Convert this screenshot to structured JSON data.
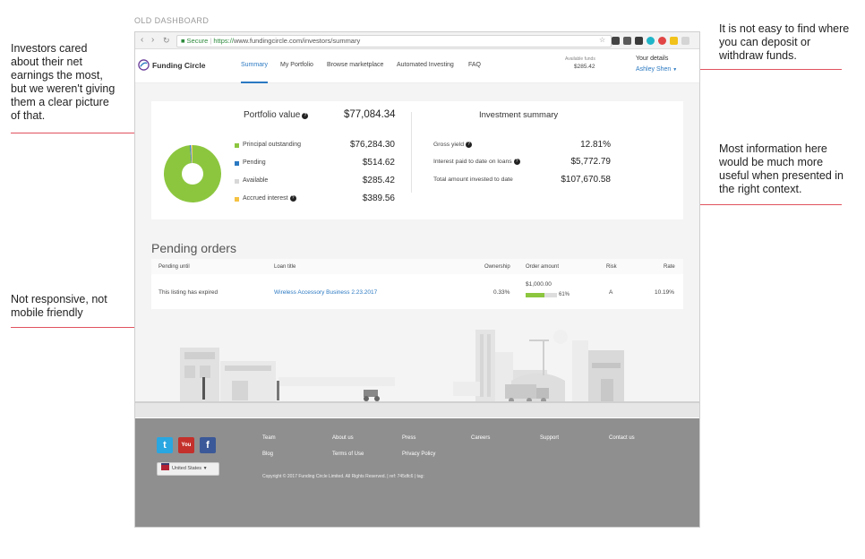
{
  "caption": "OLD DASHBOARD",
  "annotations": [
    {
      "id": "earnings",
      "text": "Investors cared about their net earnings the most, but we weren't giving them a clear picture of that."
    },
    {
      "id": "deposit",
      "text": "It is not easy to find where you can deposit or withdraw funds."
    },
    {
      "id": "context",
      "text": "Most information here would be much more useful when presented in the right context."
    },
    {
      "id": "mobile",
      "text": "Not responsive, not mobile friendly"
    }
  ],
  "browser": {
    "secure_label": "Secure",
    "url_scheme": "https://",
    "url_rest": "www.fundingcircle.com/investors/summary",
    "extension_colors": [
      "#444444",
      "#5a5a5a",
      "#3a3a3a",
      "#20b5c8",
      "#e24545",
      "#f1c21b",
      "#d5d5d5"
    ]
  },
  "header": {
    "logo": "Funding Circle",
    "nav": [
      "Summary",
      "My Portfolio",
      "Browse marketplace",
      "Automated Investing",
      "FAQ"
    ],
    "active_nav": "Summary",
    "available_funds_label": "Available funds",
    "available_funds_value": "$285.42",
    "your_details": "Your details",
    "user_name": "Ashley Shen"
  },
  "portfolio": {
    "title": "Portfolio value",
    "total": "$77,084.34",
    "items": [
      {
        "label": "Principal outstanding",
        "value": "$76,284.30",
        "color": "#8cc63f"
      },
      {
        "label": "Pending",
        "value": "$514.62",
        "color": "#2b79c2"
      },
      {
        "label": "Available",
        "value": "$285.42",
        "color": "#d8d8d8"
      },
      {
        "label": "Accrued interest",
        "value": "$389.56",
        "color": "#f5c242"
      }
    ]
  },
  "investment_summary": {
    "title": "Investment summary",
    "rows": [
      {
        "label": "Gross yield",
        "value": "12.81%",
        "help": true
      },
      {
        "label": "Interest paid to date on loans",
        "value": "$5,772.79",
        "help": true
      },
      {
        "label": "Total amount invested to date",
        "value": "$107,670.58",
        "help": false
      }
    ]
  },
  "pending_orders": {
    "title": "Pending orders",
    "columns": [
      "Pending until",
      "Loan title",
      "Ownership",
      "Order amount",
      "Risk",
      "Rate"
    ],
    "rows": [
      {
        "pending_until": "This listing has expired",
        "loan_title": "Wireless Accessory Business 2.23.2017",
        "ownership": "0.33%",
        "order_amount": "$1,000.00",
        "progress_percent": 61,
        "progress_label": "61%",
        "risk": "A",
        "rate": "10.19%"
      }
    ]
  },
  "footer": {
    "links": [
      "Team",
      "About us",
      "Press",
      "Careers",
      "Support",
      "Contact us",
      "Blog",
      "Terms of Use",
      "Privacy Policy"
    ],
    "country": "United States",
    "copyright": "Copyright © 2017 Funding Circle Limited. All Rights Reserved. | ref: 745dfc6 | tag:"
  }
}
